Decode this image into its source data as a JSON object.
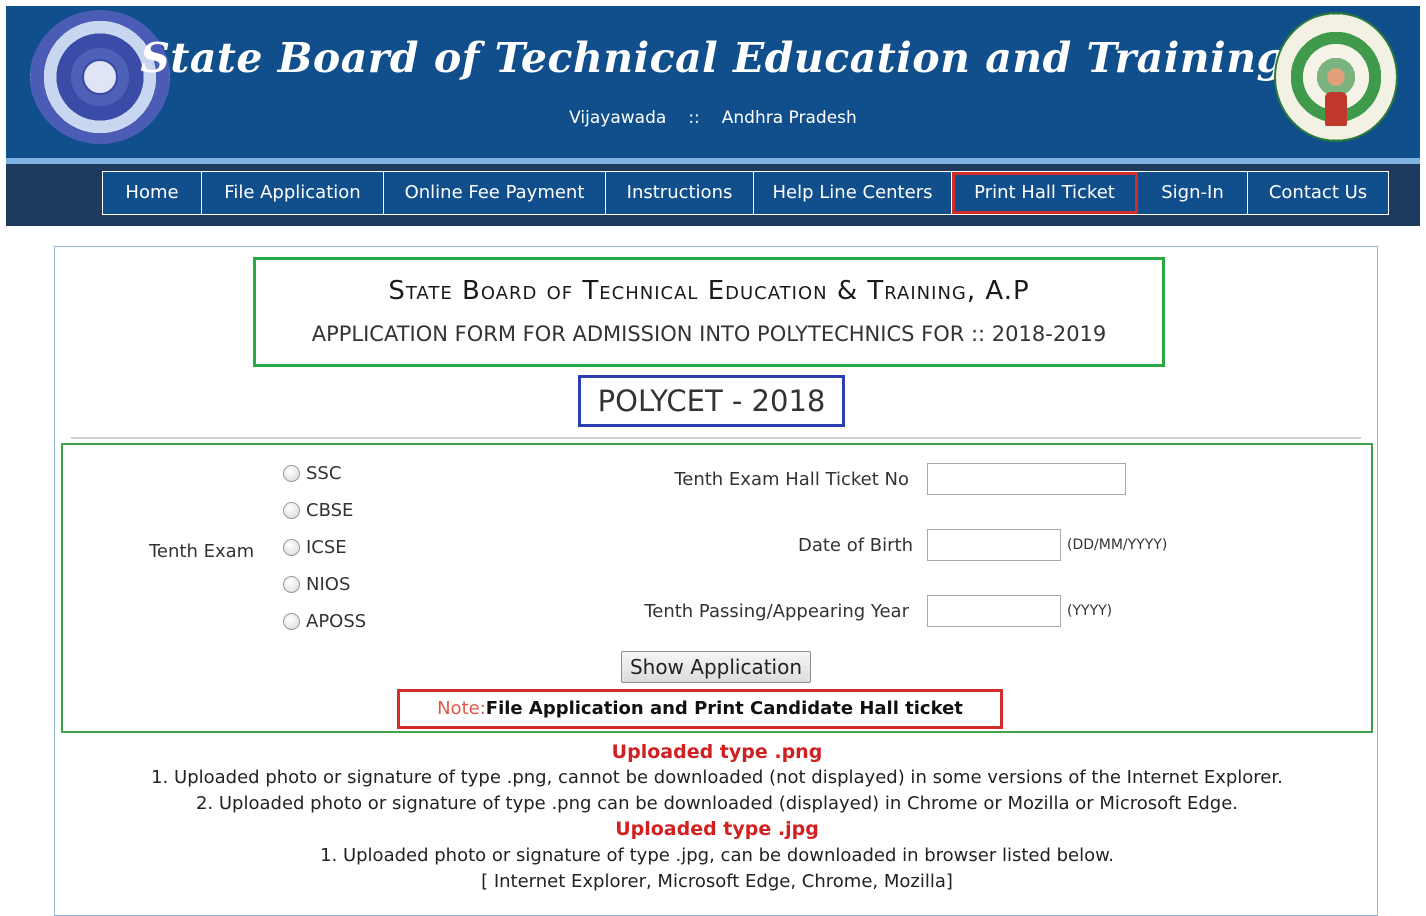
{
  "header": {
    "title": "State Board of Technical Education and Training",
    "city": "Vijayawada",
    "separator": "::",
    "state": "Andhra Pradesh"
  },
  "nav": {
    "items": [
      {
        "label": "Home"
      },
      {
        "label": "File Application"
      },
      {
        "label": "Online Fee Payment"
      },
      {
        "label": "Instructions"
      },
      {
        "label": "Help Line Centers"
      },
      {
        "label": "Print Hall Ticket"
      },
      {
        "label": "Sign-In"
      },
      {
        "label": "Contact Us"
      }
    ]
  },
  "main": {
    "title": "State Board of Technical Education & Training, A.P",
    "subtitle": "APPLICATION FORM FOR ADMISSION INTO POLYTECHNICS FOR :: 2018-2019",
    "exam_title": "POLYCET - 2018"
  },
  "form": {
    "tenth_exam_label": "Tenth Exam",
    "tenth_exam_options": [
      "SSC",
      "CBSE",
      "ICSE",
      "NIOS",
      "APOSS"
    ],
    "hall_ticket_label": "Tenth Exam Hall Ticket No",
    "hall_ticket_value": "",
    "dob_label": "Date of Birth",
    "dob_value": "",
    "dob_hint": "(DD/MM/YYYY)",
    "year_label": "Tenth Passing/Appearing Year",
    "year_value": "",
    "year_hint": "(YYYY)",
    "show_button": "Show Application",
    "note_label": "Note:",
    "note_text": "File Application and Print Candidate Hall ticket"
  },
  "info": {
    "png_head": "Uploaded type .png",
    "png_line1": "1. Uploaded photo or signature of type .png, cannot be downloaded (not displayed) in some versions of the Internet Explorer.",
    "png_line2": "2. Uploaded photo or signature of type .png can be downloaded (displayed) in Chrome or Mozilla or Microsoft Edge.",
    "jpg_head": "Uploaded type .jpg",
    "jpg_line1": "1. Uploaded photo or signature of type .jpg, can be downloaded in browser listed below.",
    "jpg_line2": "[ Internet Explorer, Microsoft Edge, Chrome, Mozilla]"
  }
}
